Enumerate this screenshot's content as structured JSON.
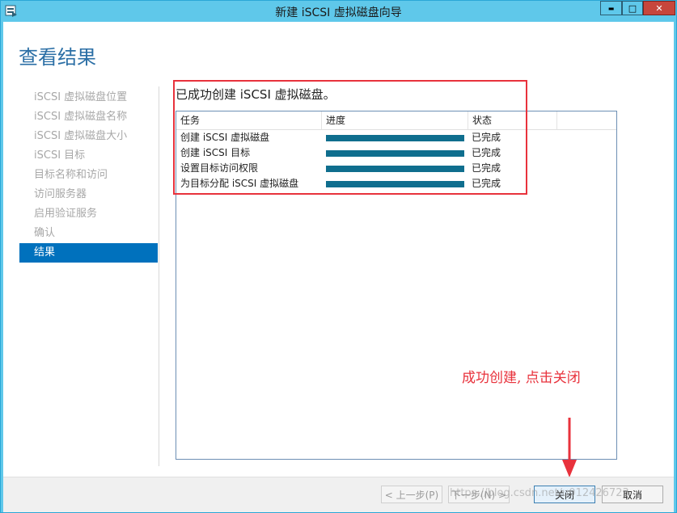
{
  "window": {
    "title": "新建 iSCSI 虚拟磁盘向导",
    "minimize_glyph": "▬",
    "maximize_glyph": "□",
    "close_glyph": "✕"
  },
  "page": {
    "title": "查看结果",
    "success_message": "已成功创建 iSCSI 虚拟磁盘。"
  },
  "nav": {
    "items": [
      {
        "label": "iSCSI 虚拟磁盘位置",
        "active": false
      },
      {
        "label": "iSCSI 虚拟磁盘名称",
        "active": false
      },
      {
        "label": "iSCSI 虚拟磁盘大小",
        "active": false
      },
      {
        "label": "iSCSI 目标",
        "active": false
      },
      {
        "label": "目标名称和访问",
        "active": false
      },
      {
        "label": "访问服务器",
        "active": false
      },
      {
        "label": "启用验证服务",
        "active": false
      },
      {
        "label": "确认",
        "active": false
      },
      {
        "label": "结果",
        "active": true
      }
    ]
  },
  "table": {
    "headers": [
      "任务",
      "进度",
      "状态",
      ""
    ],
    "rows": [
      {
        "task": "创建 iSCSI 虚拟磁盘",
        "progress": 1.0,
        "status": "已完成"
      },
      {
        "task": "创建 iSCSI 目标",
        "progress": 1.0,
        "status": "已完成"
      },
      {
        "task": "设置目标访问权限",
        "progress": 1.0,
        "status": "已完成"
      },
      {
        "task": "为目标分配 iSCSI 虚拟磁盘",
        "progress": 1.0,
        "status": "已完成"
      }
    ]
  },
  "annotation": {
    "text": "成功创建, 点击关闭",
    "color": "#e8323c"
  },
  "footer": {
    "prev_label": "< 上一步(P)",
    "next_label": "下一步(N) >",
    "close_label": "关闭",
    "cancel_label": "取消"
  },
  "watermark": {
    "text": "https://blog.csdn.net/u012426723"
  },
  "colors": {
    "accent": "#0071bd",
    "progress": "#0f6e8e",
    "title": "#2a6ea5"
  }
}
